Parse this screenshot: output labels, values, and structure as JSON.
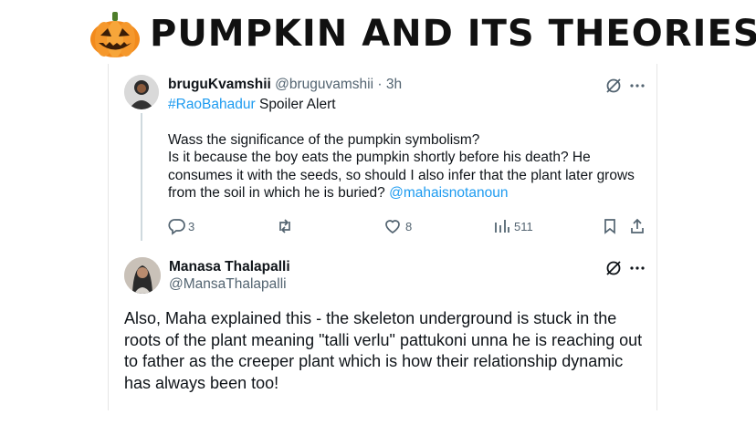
{
  "header": {
    "title": "PUMPKIN AND ITS THEORIES",
    "emoji_icon": "jack-o-lantern-icon"
  },
  "tweet1": {
    "display_name": "bruguKvamshii",
    "handle": "@bruguvamshii",
    "separator": " · ",
    "time": "3h",
    "hashtag": "#RaoBahadur",
    "line1_rest": " Spoiler Alert",
    "body_lines": [
      "Wass the significance of the pumpkin symbolism?",
      "Is it because the boy eats the pumpkin shortly before his death? He",
      "consumes it with the seeds, so should I also infer that the plant later grows",
      "from the soil in which he is buried? "
    ],
    "mention": "@mahaisnotanoun",
    "actions": {
      "replies": "3",
      "likes": "8",
      "views": "511"
    }
  },
  "tweet2": {
    "display_name": "Manasa Thalapalli",
    "handle": "@MansaThalapalli",
    "body_lines": [
      "Also, Maha explained this - the skeleton underground is stuck in the",
      "roots of the plant meaning \"talli verlu\" pattukoni unna he is reaching out",
      "to father as the creeper plant which is how their relationship dynamic",
      "has always been too!"
    ]
  },
  "colors": {
    "link": "#1d9bf0",
    "muted": "#536471",
    "text": "#0f1419",
    "pumpkin": "#f28a1c"
  }
}
